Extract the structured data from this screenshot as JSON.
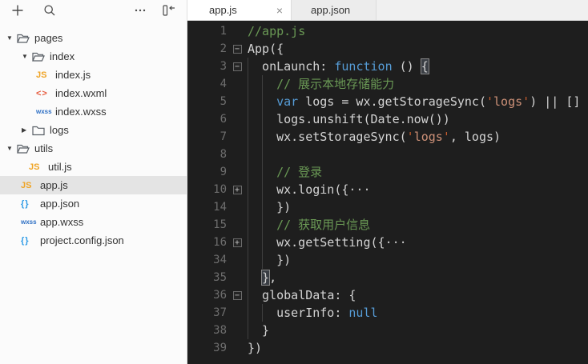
{
  "sidebar": {
    "toolbar_icons": [
      "add",
      "search",
      "more",
      "collapse-sidebar"
    ],
    "file_icon_glyphs": {
      "js": "JS",
      "wxml": "<>",
      "wxss": "wxss",
      "json": "{}"
    },
    "tree": [
      {
        "label": "pages",
        "kind": "folder",
        "state": "open",
        "level": 0
      },
      {
        "label": "index",
        "kind": "folder",
        "state": "open",
        "level": 1
      },
      {
        "label": "index.js",
        "kind": "file",
        "type": "js",
        "level": 2
      },
      {
        "label": "index.wxml",
        "kind": "file",
        "type": "wxml",
        "level": 2
      },
      {
        "label": "index.wxss",
        "kind": "file",
        "type": "wxss",
        "level": 2
      },
      {
        "label": "logs",
        "kind": "folder",
        "state": "closed",
        "level": 1
      },
      {
        "label": "utils",
        "kind": "folder",
        "state": "open",
        "level": 0
      },
      {
        "label": "util.js",
        "kind": "file",
        "type": "js",
        "level": 1
      },
      {
        "label": "app.js",
        "kind": "file",
        "type": "js",
        "level": 0,
        "selected": true
      },
      {
        "label": "app.json",
        "kind": "file",
        "type": "json",
        "level": 0
      },
      {
        "label": "app.wxss",
        "kind": "file",
        "type": "wxss",
        "level": 0
      },
      {
        "label": "project.config.json",
        "kind": "file",
        "type": "json",
        "level": 0
      }
    ]
  },
  "tabs": [
    {
      "label": "app.js",
      "active": true,
      "closable": true,
      "close_glyph": "×"
    },
    {
      "label": "app.json",
      "active": false,
      "closable": false
    }
  ],
  "editor": {
    "colors": {
      "background": "#1e1e1e",
      "keyword": "#569cd6",
      "comment": "#6a9955",
      "string": "#ce9178",
      "string_quote": "#c75c2c",
      "default": "#d4d4d4"
    },
    "lines": [
      {
        "num": 1,
        "fold": null,
        "guides": 0,
        "tokens": [
          [
            "com",
            "//app.js"
          ]
        ]
      },
      {
        "num": 2,
        "fold": "minus",
        "guides": 0,
        "tokens": [
          [
            "def",
            "App({"
          ]
        ]
      },
      {
        "num": 3,
        "fold": "minus",
        "guides": 1,
        "tokens": [
          [
            "def",
            "onLaunch: "
          ],
          [
            "kw",
            "function"
          ],
          [
            "def",
            " () "
          ],
          [
            "def bm",
            "{"
          ]
        ]
      },
      {
        "num": 4,
        "fold": null,
        "guides": 2,
        "tokens": [
          [
            "com",
            "// 展示本地存储能力"
          ]
        ]
      },
      {
        "num": 5,
        "fold": null,
        "guides": 2,
        "tokens": [
          [
            "kw",
            "var"
          ],
          [
            "def",
            " logs = wx.getStorageSync("
          ],
          [
            "q",
            "'"
          ],
          [
            "str",
            "logs"
          ],
          [
            "q",
            "'"
          ],
          [
            "def",
            ") || []"
          ]
        ]
      },
      {
        "num": 6,
        "fold": null,
        "guides": 2,
        "tokens": [
          [
            "def",
            "logs.unshift(Date.now())"
          ]
        ]
      },
      {
        "num": 7,
        "fold": null,
        "guides": 2,
        "tokens": [
          [
            "def",
            "wx.setStorageSync("
          ],
          [
            "q",
            "'"
          ],
          [
            "str",
            "logs"
          ],
          [
            "q",
            "'"
          ],
          [
            "def",
            ", logs)"
          ]
        ]
      },
      {
        "num": 8,
        "fold": null,
        "guides": 2,
        "tokens": []
      },
      {
        "num": 9,
        "fold": null,
        "guides": 2,
        "tokens": [
          [
            "com",
            "// 登录"
          ]
        ]
      },
      {
        "num": 10,
        "fold": "plus",
        "guides": 2,
        "tokens": [
          [
            "def",
            "wx.login({"
          ],
          [
            "ell",
            "···"
          ]
        ]
      },
      {
        "num": 14,
        "fold": null,
        "guides": 2,
        "tokens": [
          [
            "def",
            "})"
          ]
        ]
      },
      {
        "num": 15,
        "fold": null,
        "guides": 2,
        "tokens": [
          [
            "com",
            "// 获取用户信息"
          ]
        ]
      },
      {
        "num": 16,
        "fold": "plus",
        "guides": 2,
        "tokens": [
          [
            "def",
            "wx.getSetting({"
          ],
          [
            "ell",
            "···"
          ]
        ]
      },
      {
        "num": 34,
        "fold": null,
        "guides": 2,
        "tokens": [
          [
            "def",
            "})"
          ]
        ]
      },
      {
        "num": 35,
        "fold": null,
        "guides": 1,
        "tokens": [
          [
            "def bm",
            "}"
          ],
          [
            "def",
            ","
          ]
        ]
      },
      {
        "num": 36,
        "fold": "minus",
        "guides": 1,
        "tokens": [
          [
            "def",
            "globalData: {"
          ]
        ]
      },
      {
        "num": 37,
        "fold": null,
        "guides": 2,
        "tokens": [
          [
            "def",
            "userInfo: "
          ],
          [
            "kw",
            "null"
          ]
        ]
      },
      {
        "num": 38,
        "fold": null,
        "guides": 1,
        "tokens": [
          [
            "def",
            "}"
          ]
        ]
      },
      {
        "num": 39,
        "fold": null,
        "guides": 0,
        "tokens": [
          [
            "def",
            "})"
          ]
        ]
      }
    ]
  }
}
